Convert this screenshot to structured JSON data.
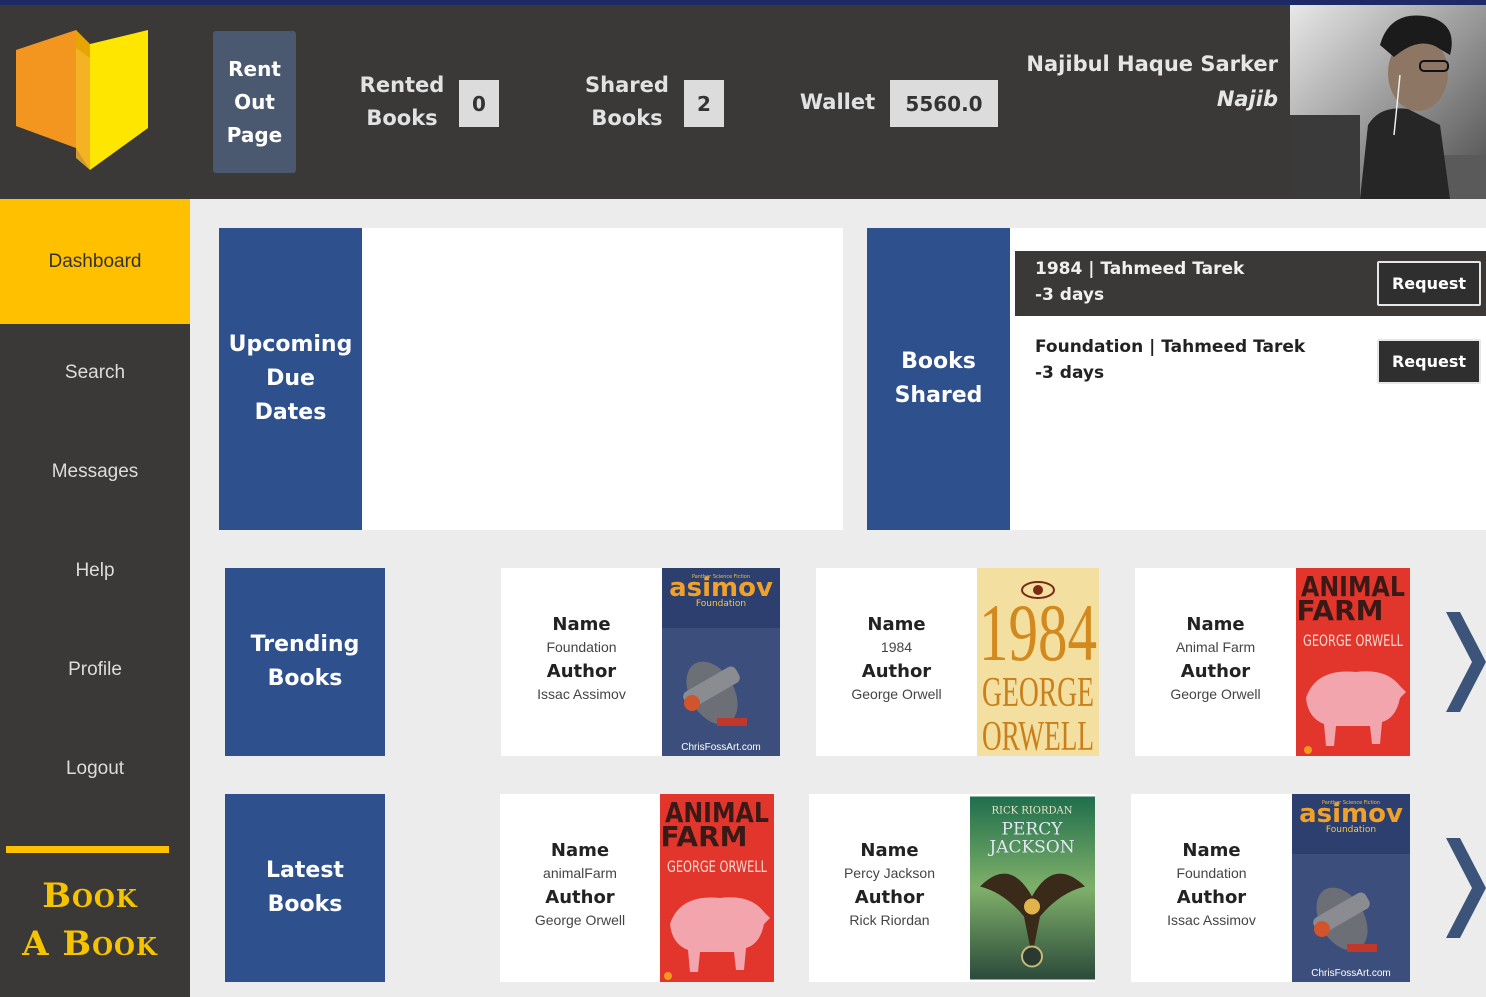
{
  "header": {
    "rent_out_button": "Rent Out Page",
    "rented_books": {
      "label_1": "Rented",
      "label_2": "Books",
      "value": "0"
    },
    "shared_books": {
      "label_1": "Shared",
      "label_2": "Books",
      "value": "2"
    },
    "wallet": {
      "label": "Wallet",
      "value": "5560.0"
    },
    "user": {
      "name": "Najibul Haque Sarker",
      "nickname": "Najib"
    }
  },
  "sidebar": {
    "items": [
      {
        "label": "Dashboard",
        "active": true
      },
      {
        "label": "Search"
      },
      {
        "label": "Messages"
      },
      {
        "label": "Help"
      },
      {
        "label": "Profile"
      },
      {
        "label": "Logout"
      }
    ],
    "brand_line_1": "Book",
    "brand_line_2": "A Book"
  },
  "upcoming": {
    "line_1": "Upcoming",
    "line_2": "Due",
    "line_3": "Dates"
  },
  "books_shared": {
    "line_1": "Books",
    "line_2": "Shared",
    "items": [
      {
        "title": "1984 | Tahmeed Tarek",
        "days": "-3 days",
        "button": "Request"
      },
      {
        "title": "Foundation | Tahmeed Tarek",
        "days": "-3 days",
        "button": "Request"
      }
    ]
  },
  "labels": {
    "name": "Name",
    "author": "Author"
  },
  "trending": {
    "line_1": "Trending",
    "line_2": "Books",
    "books": [
      {
        "name": "Foundation",
        "author": "Issac Assimov",
        "cover_title": "asimov",
        "cover_sub": "Foundation",
        "cover_credit": "ChrisFossArt.com",
        "cover_tag": "Panther Science Fiction"
      },
      {
        "name": "1984",
        "author": "George Orwell",
        "cover_title": "1984",
        "cover_sub": "GEORGE",
        "cover_sub2": "ORWELL"
      },
      {
        "name": "Animal Farm",
        "author": "George Orwell",
        "cover_title": "ANIMAL",
        "cover_title2": "FARM",
        "cover_sub": "GEORGE ORWELL"
      }
    ]
  },
  "latest": {
    "line_1": "Latest",
    "line_2": "Books",
    "books": [
      {
        "name": "animalFarm",
        "author": "George Orwell",
        "cover_title": "ANIMAL",
        "cover_title2": "FARM",
        "cover_sub": "GEORGE ORWELL"
      },
      {
        "name": "Percy Jackson",
        "author": "Rick Riordan",
        "cover_author": "RICK RIORDAN",
        "cover_title": "PERCY",
        "cover_title2": "JACKSON"
      },
      {
        "name": "Foundation",
        "author": "Issac Assimov",
        "cover_title": "asimov",
        "cover_sub": "Foundation",
        "cover_credit": "ChrisFossArt.com",
        "cover_tag": "Panther Science Fiction"
      }
    ]
  },
  "colors": {
    "accent": "#ffc000",
    "header_bg": "#3a3938",
    "label_blue": "#2e508c"
  }
}
